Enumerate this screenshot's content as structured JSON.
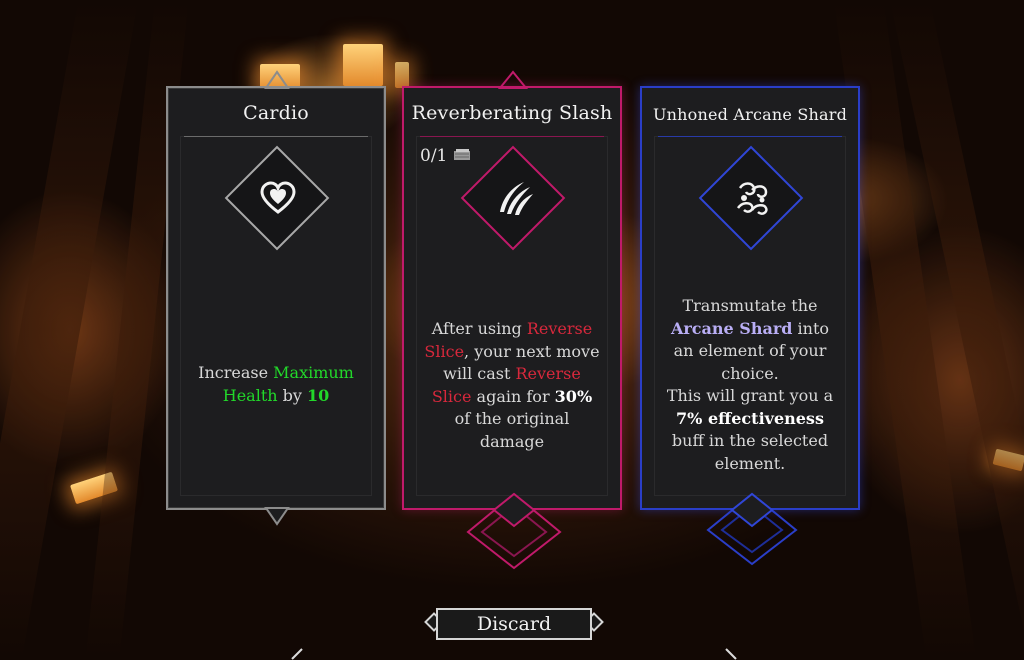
{
  "cards": [
    {
      "title": "Cardio",
      "icon": "heart-icon",
      "desc": {
        "p1": "Increase ",
        "hl1": "Maximum Health",
        "p2": " by ",
        "hl2": "10"
      },
      "colors": {
        "frame": "#8c8c8c"
      }
    },
    {
      "title": "Reverberating Slash",
      "progress": "0/1",
      "icon": "claw-slash-icon",
      "desc": {
        "p1": "After using ",
        "hl1": "Reverse Slice",
        "p2": ", your next move will cast ",
        "hl2": "Reverse Slice",
        "p3": " again for ",
        "hl3": "30%",
        "p4": " of the original damage"
      },
      "colors": {
        "frame": "#c01a6a",
        "highlight": "#d8283c"
      }
    },
    {
      "title": "Unhoned Arcane Shard",
      "icon": "arcane-shard-icon",
      "desc": {
        "p1": "Transmutate the ",
        "hl1": "Arcane Shard",
        "p2": " into an element of your choice.",
        "p3": "This will grant you a ",
        "hl2": "7% effectiveness",
        "p4": " buff in the selected element."
      },
      "colors": {
        "frame": "#2a3ec8",
        "highlight": "#b9aef5"
      }
    }
  ],
  "discard_label": "Discard",
  "accent_green": "#22d82a"
}
